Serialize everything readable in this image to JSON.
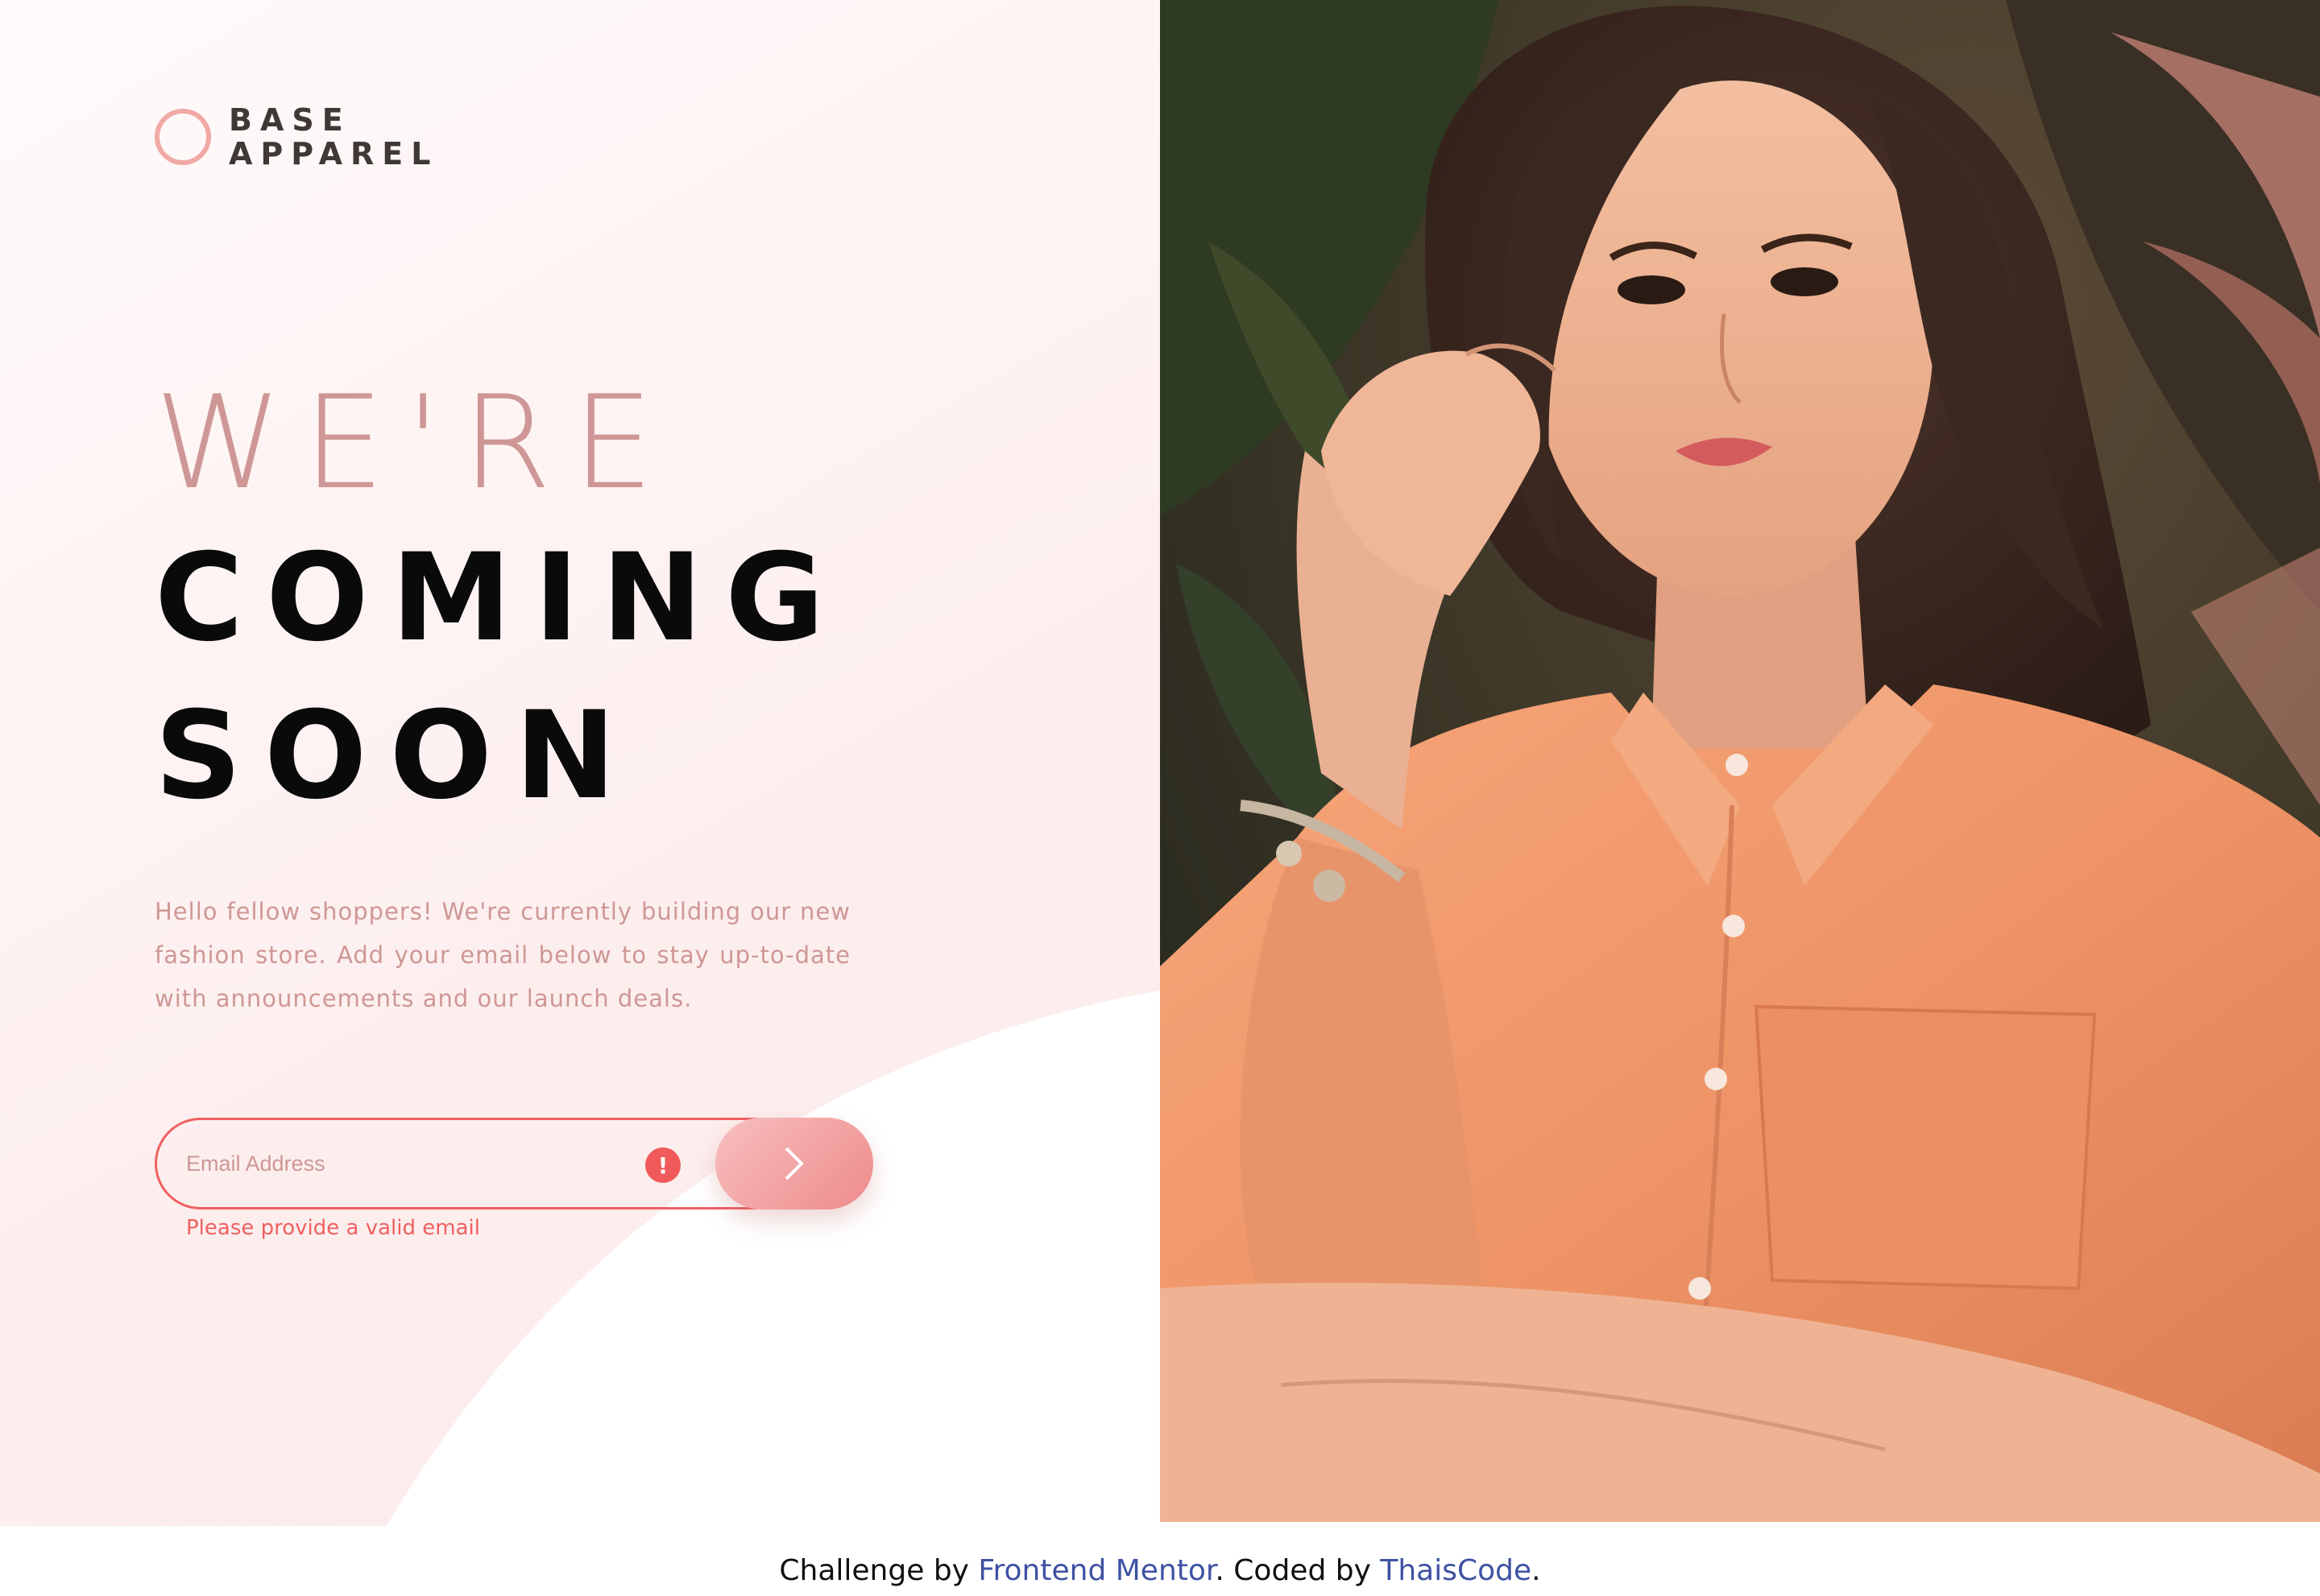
{
  "brand": {
    "line1": "BASE",
    "line2": "APPAREL"
  },
  "hero": {
    "line1": "WE'RE",
    "line2": "COMING",
    "line3": "SOON"
  },
  "intro": "Hello fellow shoppers! We're currently building our new fashion store. Add your email below to stay up-to-date with announcements and our launch deals.",
  "form": {
    "email_placeholder": "Email Address",
    "email_value": "",
    "error_icon": "!",
    "error_message": "Please provide a valid email",
    "submit_icon": "chevron-right-icon"
  },
  "photo": {
    "alt": "Woman in an orange shirt in front of tropical plants"
  },
  "footer": {
    "prefix": "Challenge by ",
    "link1": "Frontend Mentor",
    "middle": ". Coded by ",
    "link2": "ThaisCode",
    "suffix": "."
  },
  "colors": {
    "accent": "#ce9795",
    "error": "#f06060",
    "dark": "#3f3836",
    "link": "#3e52a3"
  }
}
